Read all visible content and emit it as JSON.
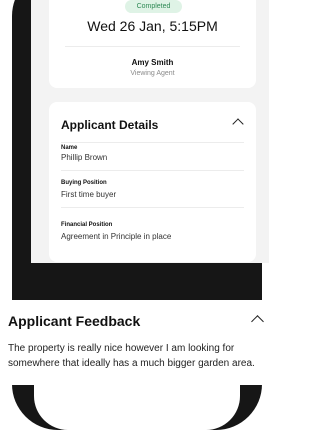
{
  "booking": {
    "status": "Completed",
    "datetime": "Wed 26 Jan, 5:15PM",
    "agent_name": "Amy Smith",
    "agent_role": "Viewing Agent"
  },
  "applicant_details": {
    "title": "Applicant Details",
    "fields": [
      {
        "label": "Name",
        "value": "Phillip Brown"
      },
      {
        "label": "Buying Position",
        "value": "First time buyer"
      },
      {
        "label": "Financial Position",
        "value": "Agreement in Principle in place"
      }
    ]
  },
  "feedback": {
    "title": "Applicant Feedback",
    "text": "The property is really nice however I am looking for somewhere that ideally has a much bigger garden area."
  },
  "colors": {
    "badge_bg": "#dff3e6",
    "badge_text": "#2f8a55",
    "phone_frame": "#161616"
  }
}
